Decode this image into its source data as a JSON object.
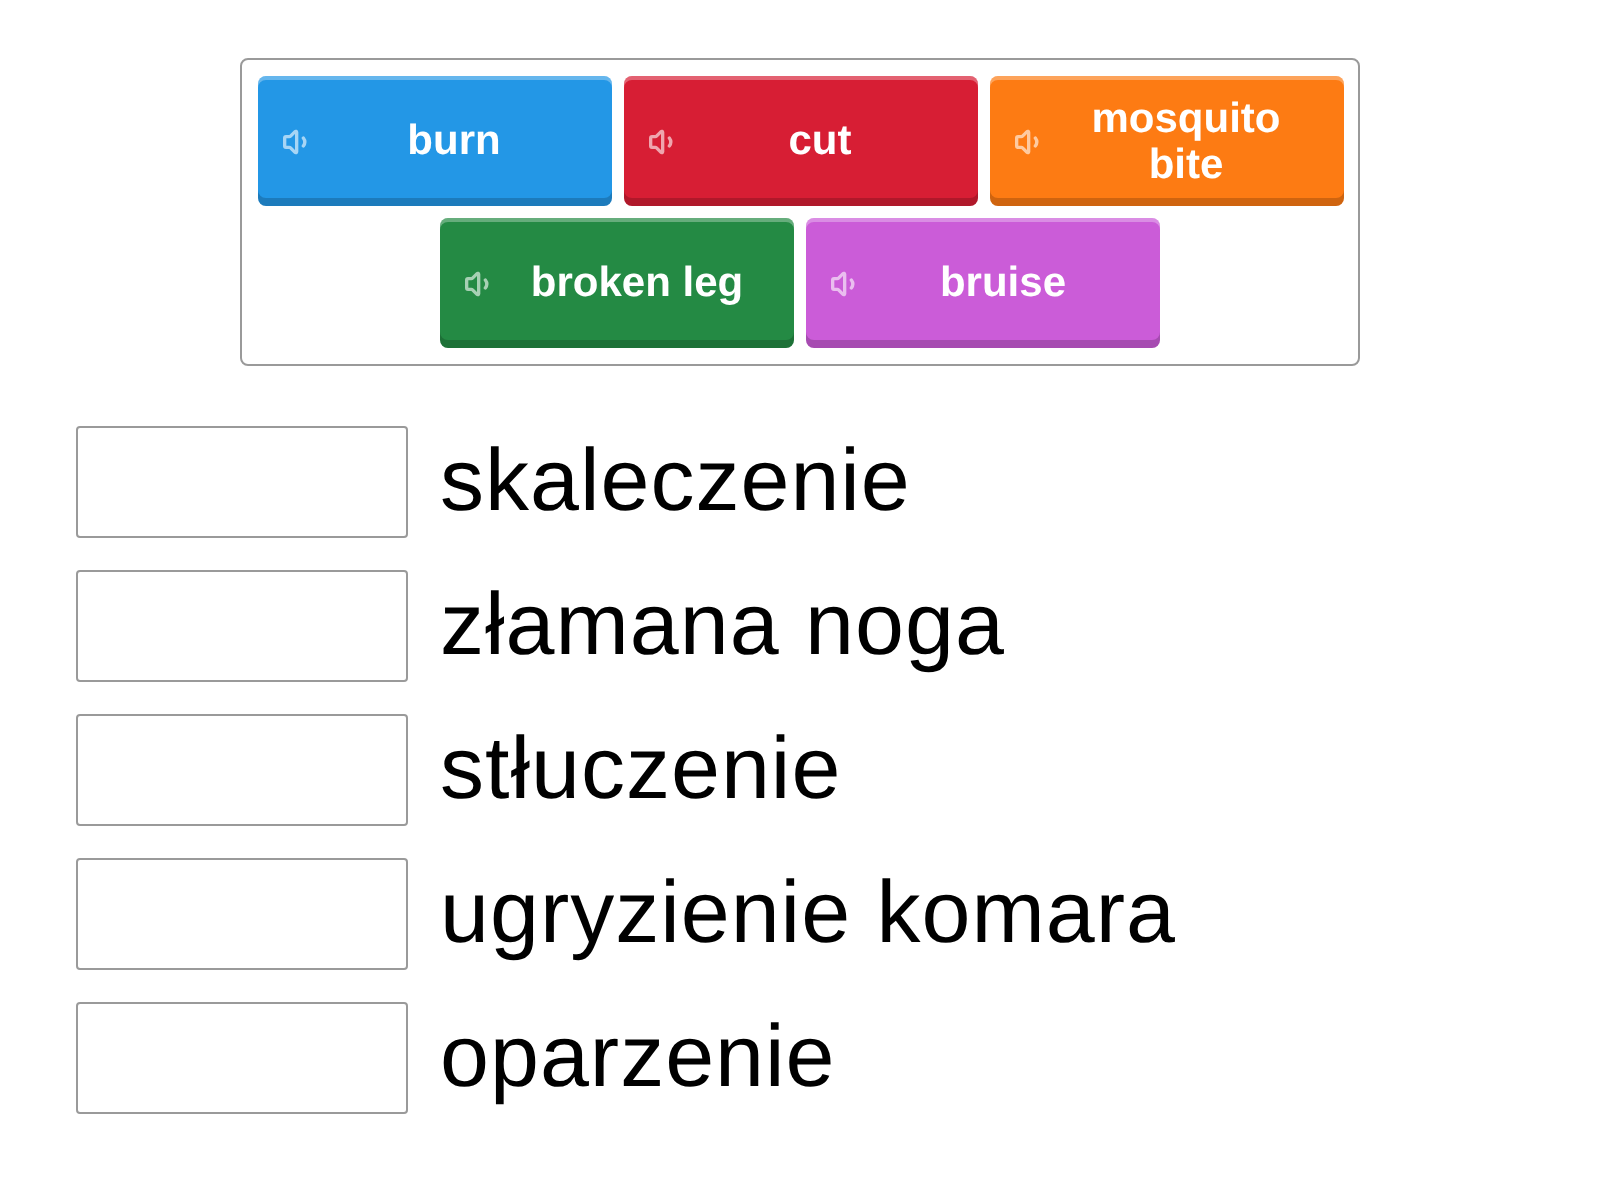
{
  "tiles": [
    {
      "label": "burn",
      "color": "#2397e6"
    },
    {
      "label": "cut",
      "color": "#d71e34"
    },
    {
      "label": "mosquito bite",
      "color": "#fd7b13"
    },
    {
      "label": "broken leg",
      "color": "#248a44"
    },
    {
      "label": "bruise",
      "color": "#cb5cd8"
    }
  ],
  "answers": [
    {
      "label": "skaleczenie"
    },
    {
      "label": "złamana noga"
    },
    {
      "label": "stłuczenie"
    },
    {
      "label": "ugryzienie komara"
    },
    {
      "label": "oparzenie"
    }
  ]
}
